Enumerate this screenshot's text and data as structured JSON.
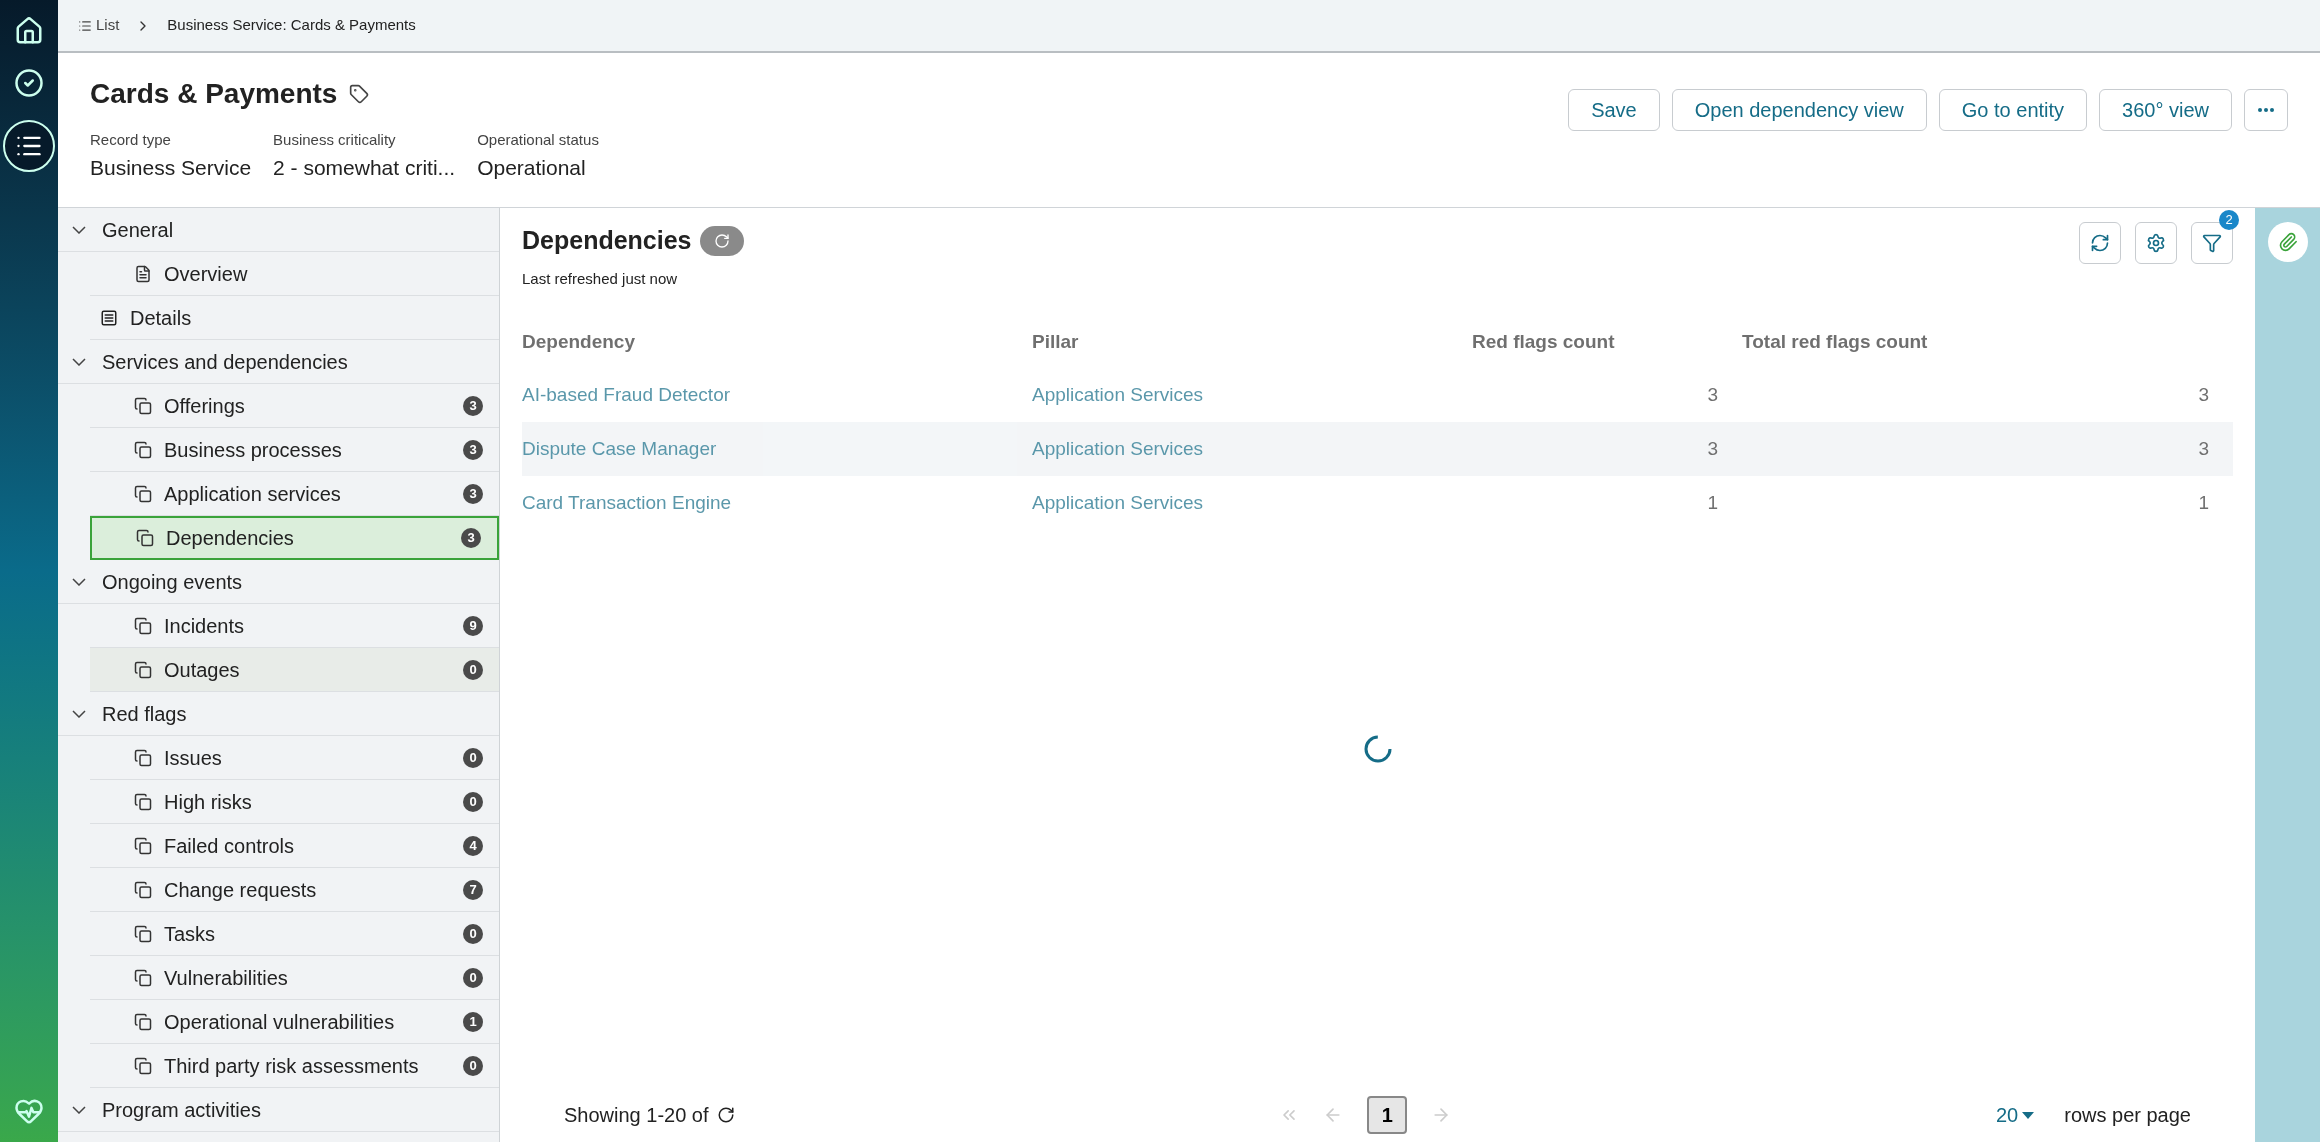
{
  "breadcrumb": {
    "list_label": "List",
    "current": "Business Service: Cards & Payments"
  },
  "record": {
    "title": "Cards & Payments",
    "fields": [
      {
        "label": "Record type",
        "value": "Business Service"
      },
      {
        "label": "Business criticality",
        "value": "2 - somewhat criti..."
      },
      {
        "label": "Operational status",
        "value": "Operational"
      }
    ]
  },
  "actions": [
    "Save",
    "Open dependency view",
    "Go to entity",
    "360° view"
  ],
  "sidebar": {
    "items": [
      {
        "kind": "group",
        "label": "General",
        "expanded": true,
        "children": [
          {
            "kind": "page",
            "label": "Overview",
            "selected": false,
            "hovered": false
          }
        ]
      },
      {
        "kind": "record",
        "label": "Details",
        "selected": false,
        "hovered": false
      },
      {
        "kind": "group",
        "label": "Services and dependencies",
        "expanded": true,
        "children": [
          {
            "kind": "copy",
            "label": "Offerings",
            "count": "3",
            "selected": false,
            "hovered": false
          },
          {
            "kind": "copy",
            "label": "Business processes",
            "count": "3",
            "selected": false,
            "hovered": false
          },
          {
            "kind": "copy",
            "label": "Application services",
            "count": "3",
            "selected": false,
            "hovered": false
          },
          {
            "kind": "copy",
            "label": "Dependencies",
            "count": "3",
            "selected": true,
            "hovered": false
          }
        ]
      },
      {
        "kind": "group",
        "label": "Ongoing events",
        "expanded": true,
        "children": [
          {
            "kind": "copy",
            "label": "Incidents",
            "count": "9",
            "selected": false,
            "hovered": false
          },
          {
            "kind": "copy",
            "label": "Outages",
            "count": "0",
            "selected": false,
            "hovered": true
          }
        ]
      },
      {
        "kind": "group",
        "label": "Red flags",
        "expanded": true,
        "children": [
          {
            "kind": "copy",
            "label": "Issues",
            "count": "0",
            "selected": false,
            "hovered": false
          },
          {
            "kind": "copy",
            "label": "High risks",
            "count": "0",
            "selected": false,
            "hovered": false
          },
          {
            "kind": "copy",
            "label": "Failed controls",
            "count": "4",
            "selected": false,
            "hovered": false
          },
          {
            "kind": "copy",
            "label": "Change requests",
            "count": "7",
            "selected": false,
            "hovered": false
          },
          {
            "kind": "copy",
            "label": "Tasks",
            "count": "0",
            "selected": false,
            "hovered": false
          },
          {
            "kind": "copy",
            "label": "Vulnerabilities",
            "count": "0",
            "selected": false,
            "hovered": false
          },
          {
            "kind": "copy",
            "label": "Operational vulnerabilities",
            "count": "1",
            "selected": false,
            "hovered": false
          },
          {
            "kind": "copy",
            "label": "Third party risk assessments",
            "count": "0",
            "selected": false,
            "hovered": false
          }
        ]
      },
      {
        "kind": "group",
        "label": "Program activities",
        "expanded": true
      }
    ]
  },
  "panel": {
    "title": "Dependencies",
    "subtitle": "Last refreshed just now",
    "filter_count": "2",
    "loading": true,
    "table": {
      "columns": [
        "Dependency",
        "Pillar",
        "Red flags count",
        "Total red flags count"
      ],
      "rows": [
        [
          "AI-based Fraud Detector",
          "Application Services",
          "3",
          "3"
        ],
        [
          "Dispute Case Manager",
          "Application Services",
          "3",
          "3"
        ],
        [
          "Card Transaction Engine",
          "Application Services",
          "1",
          "1"
        ]
      ]
    }
  },
  "footer": {
    "showing": "Showing 1-20 of",
    "page": "1",
    "page_size": "20",
    "rows_label": "rows per page"
  }
}
